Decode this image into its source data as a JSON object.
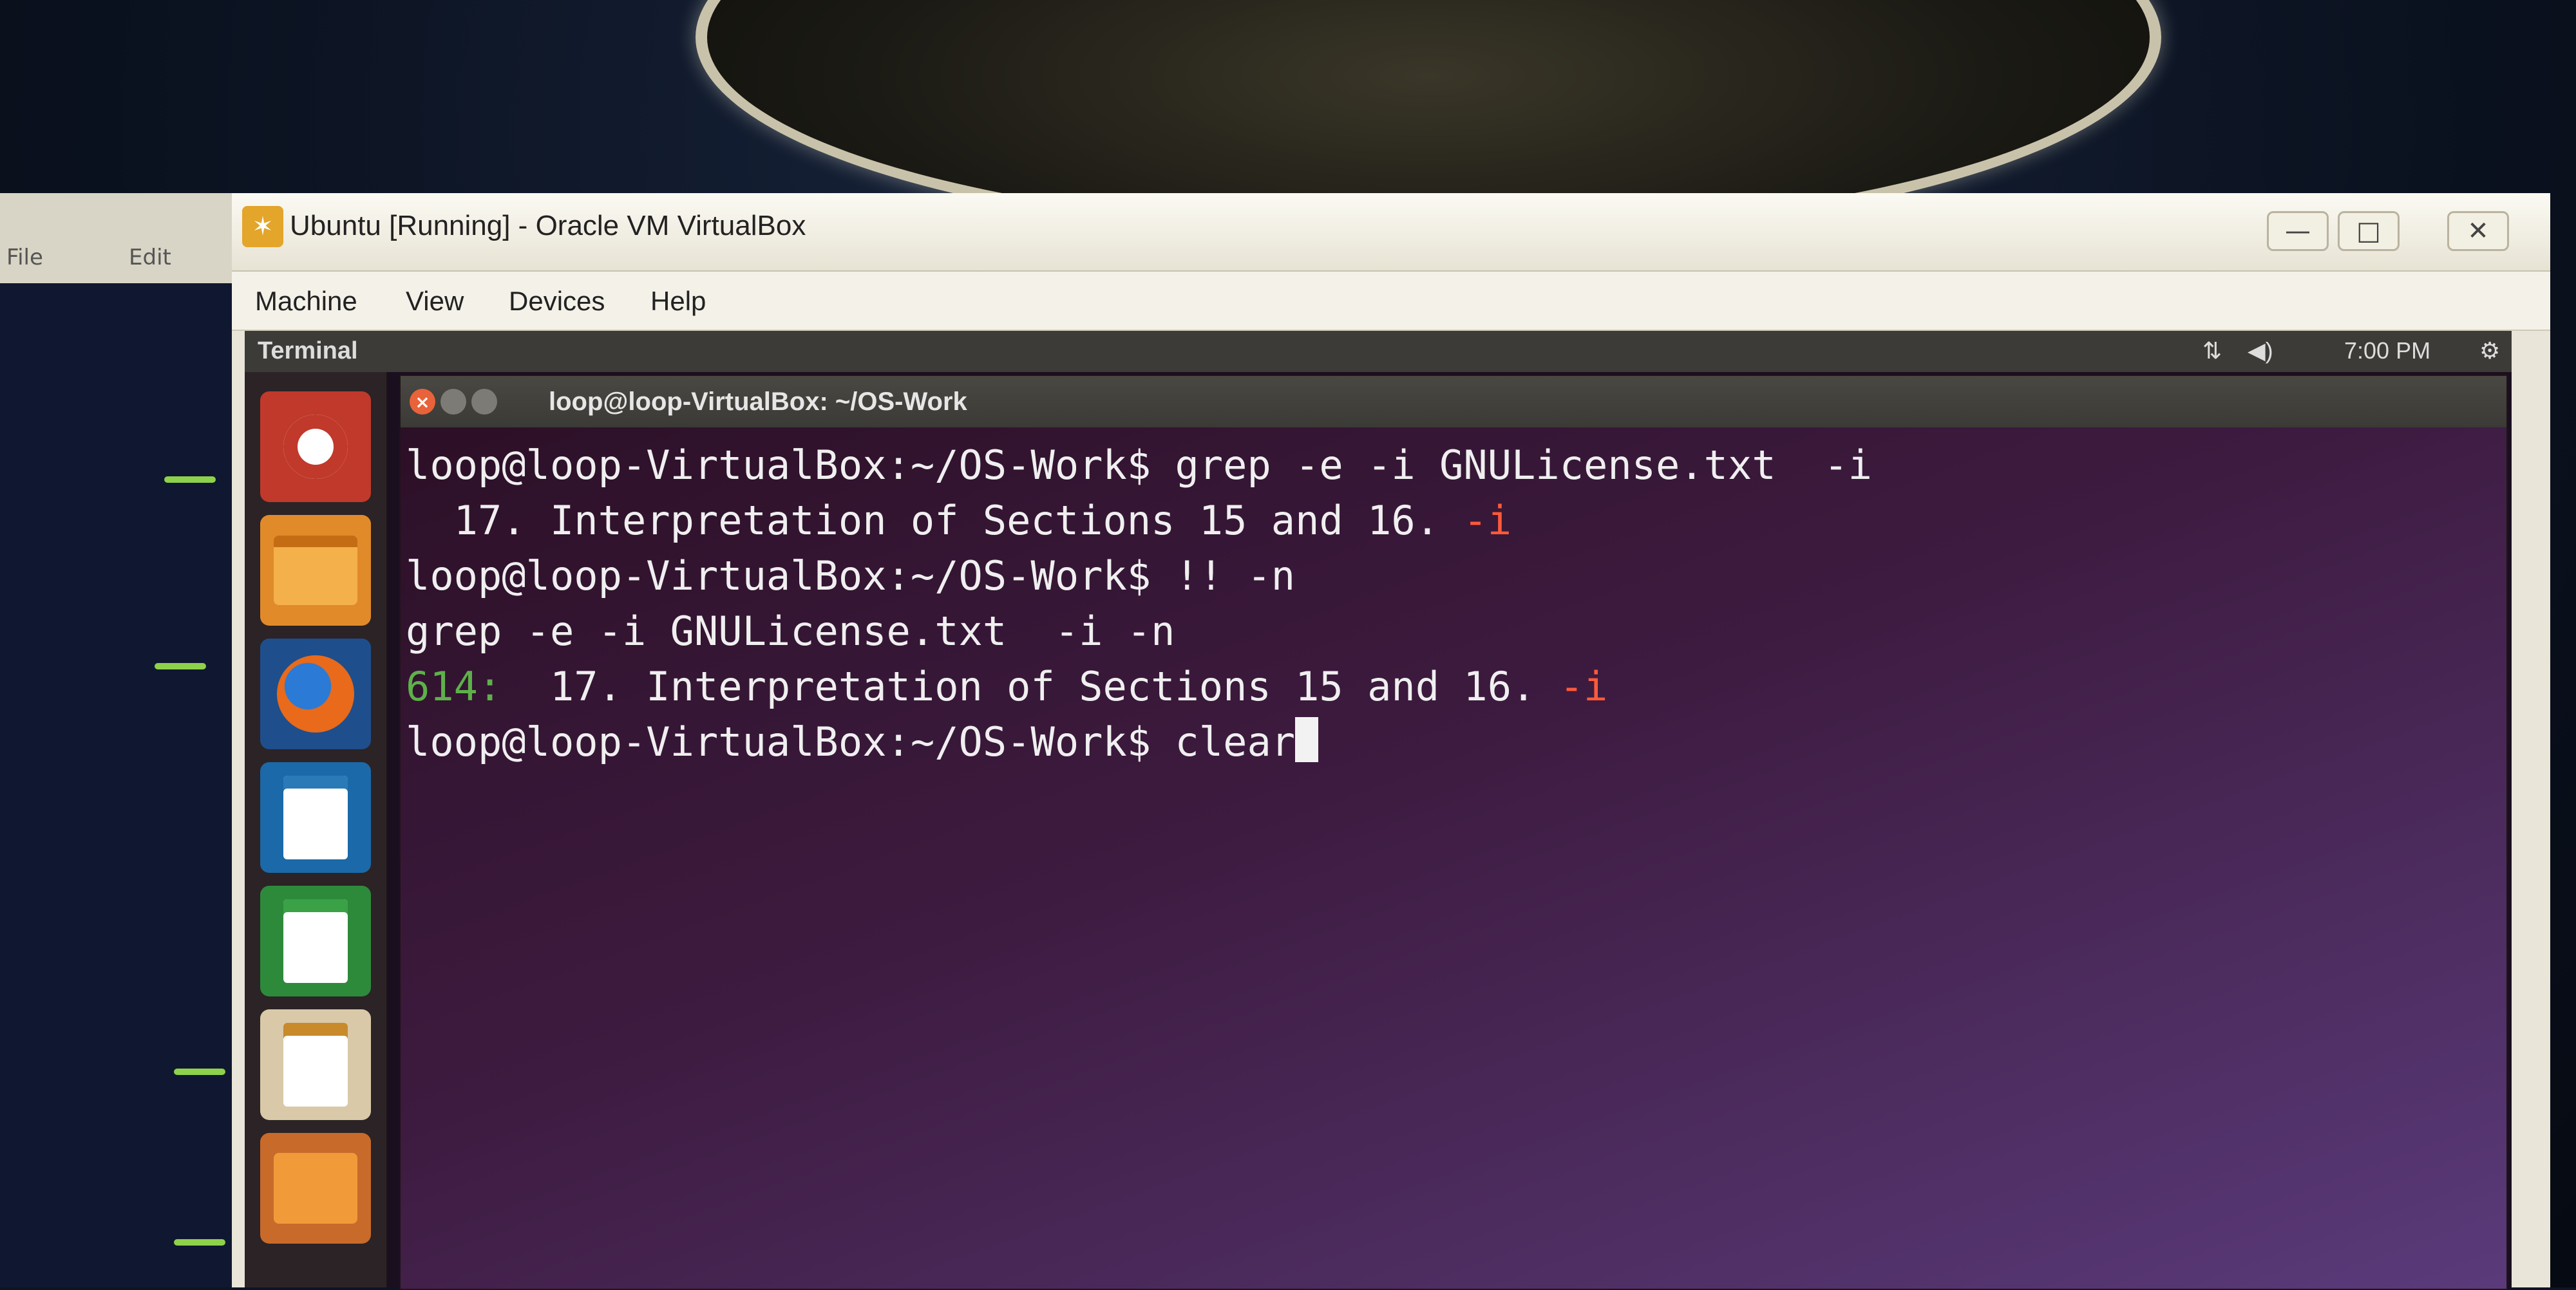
{
  "host": {
    "left_labels": [
      "File",
      "Edit"
    ]
  },
  "vbox": {
    "title": "Ubuntu [Running] - Oracle VM VirtualBox",
    "menu": [
      "Machine",
      "View",
      "Devices",
      "Help"
    ],
    "window_buttons": {
      "minimize": "—",
      "maximize": "□",
      "close": "✕"
    }
  },
  "ubuntu": {
    "topbar_label": "Terminal",
    "time": "7:00 PM",
    "launcher": [
      "ubuntu-dash",
      "files",
      "firefox",
      "libreoffice-writer",
      "libreoffice-calc",
      "libreoffice-impress",
      "software-center"
    ]
  },
  "terminal": {
    "title": "loop@loop-VirtualBox: ~/OS-Work",
    "lines": [
      {
        "prompt": "loop@loop-VirtualBox:~/OS-Work$ ",
        "command": "grep -e -i GNULicense.txt  -i"
      },
      {
        "text": "  17. Interpretation of Sections 15 and 16. ",
        "highlight": "-i"
      },
      {
        "prompt": "loop@loop-VirtualBox:~/OS-Work$ ",
        "command": "!! -n"
      },
      {
        "text": "grep -e -i GNULicense.txt  -i -n"
      },
      {
        "line_no": "614:",
        "text": "  17. Interpretation of Sections 15 and 16. ",
        "highlight": "-i"
      },
      {
        "prompt": "loop@loop-VirtualBox:~/OS-Work$ ",
        "command": "clear"
      }
    ]
  },
  "colors": {
    "terminal_bg": "#3d1b40",
    "match_highlight": "#ff5a3a",
    "line_number": "#5eb04a",
    "ubuntu_orange": "#e8623a"
  }
}
